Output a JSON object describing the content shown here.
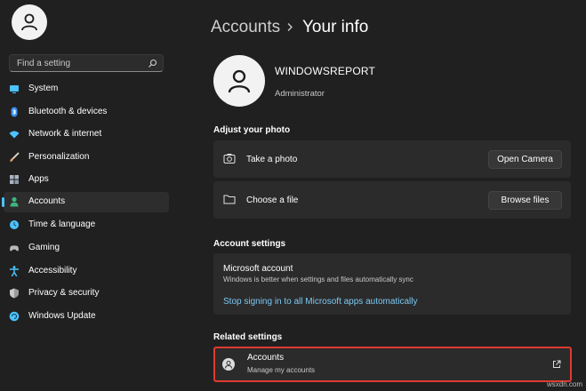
{
  "sidebar": {
    "search_placeholder": "Find a setting",
    "items": [
      {
        "label": "System",
        "icon": "monitor-icon",
        "color": "#4cc2ff"
      },
      {
        "label": "Bluetooth & devices",
        "icon": "bluetooth-icon",
        "color": "#3b8eea"
      },
      {
        "label": "Network & internet",
        "icon": "wifi-icon",
        "color": "#4cc2ff"
      },
      {
        "label": "Personalization",
        "icon": "brush-icon",
        "color": "#f0a35e"
      },
      {
        "label": "Apps",
        "icon": "apps-icon",
        "color": "#a9b3c4"
      },
      {
        "label": "Accounts",
        "icon": "person-icon",
        "color": "#3fb47f"
      },
      {
        "label": "Time & language",
        "icon": "globe-clock-icon",
        "color": "#4cc2ff"
      },
      {
        "label": "Gaming",
        "icon": "gamepad-icon",
        "color": "#b8b8b8"
      },
      {
        "label": "Accessibility",
        "icon": "accessibility-icon",
        "color": "#4cc2ff"
      },
      {
        "label": "Privacy & security",
        "icon": "shield-icon",
        "color": "#9a9a9a"
      },
      {
        "label": "Windows Update",
        "icon": "update-icon",
        "color": "#4cc2ff"
      }
    ],
    "selected_index": 5
  },
  "header": {
    "parent": "Accounts",
    "current": "Your info"
  },
  "profile": {
    "username": "WINDOWSREPORT",
    "role": "Administrator"
  },
  "adjust_photo": {
    "title": "Adjust your photo",
    "take_photo_label": "Take a photo",
    "open_camera_button": "Open Camera",
    "choose_file_label": "Choose a file",
    "browse_files_button": "Browse files"
  },
  "account_settings": {
    "title": "Account settings",
    "ms_account_title": "Microsoft account",
    "ms_account_subtitle": "Windows is better when settings and files automatically sync",
    "stop_signing_link": "Stop signing in to all Microsoft apps automatically"
  },
  "related_settings": {
    "title": "Related settings",
    "accounts_title": "Accounts",
    "accounts_subtitle": "Manage my accounts"
  },
  "watermark": "wsxdn.com",
  "colors": {
    "background": "#202020",
    "card": "#2b2b2b",
    "accent": "#4cc2ff",
    "link": "#7cc8f4",
    "highlight_border": "#e03a2f"
  }
}
